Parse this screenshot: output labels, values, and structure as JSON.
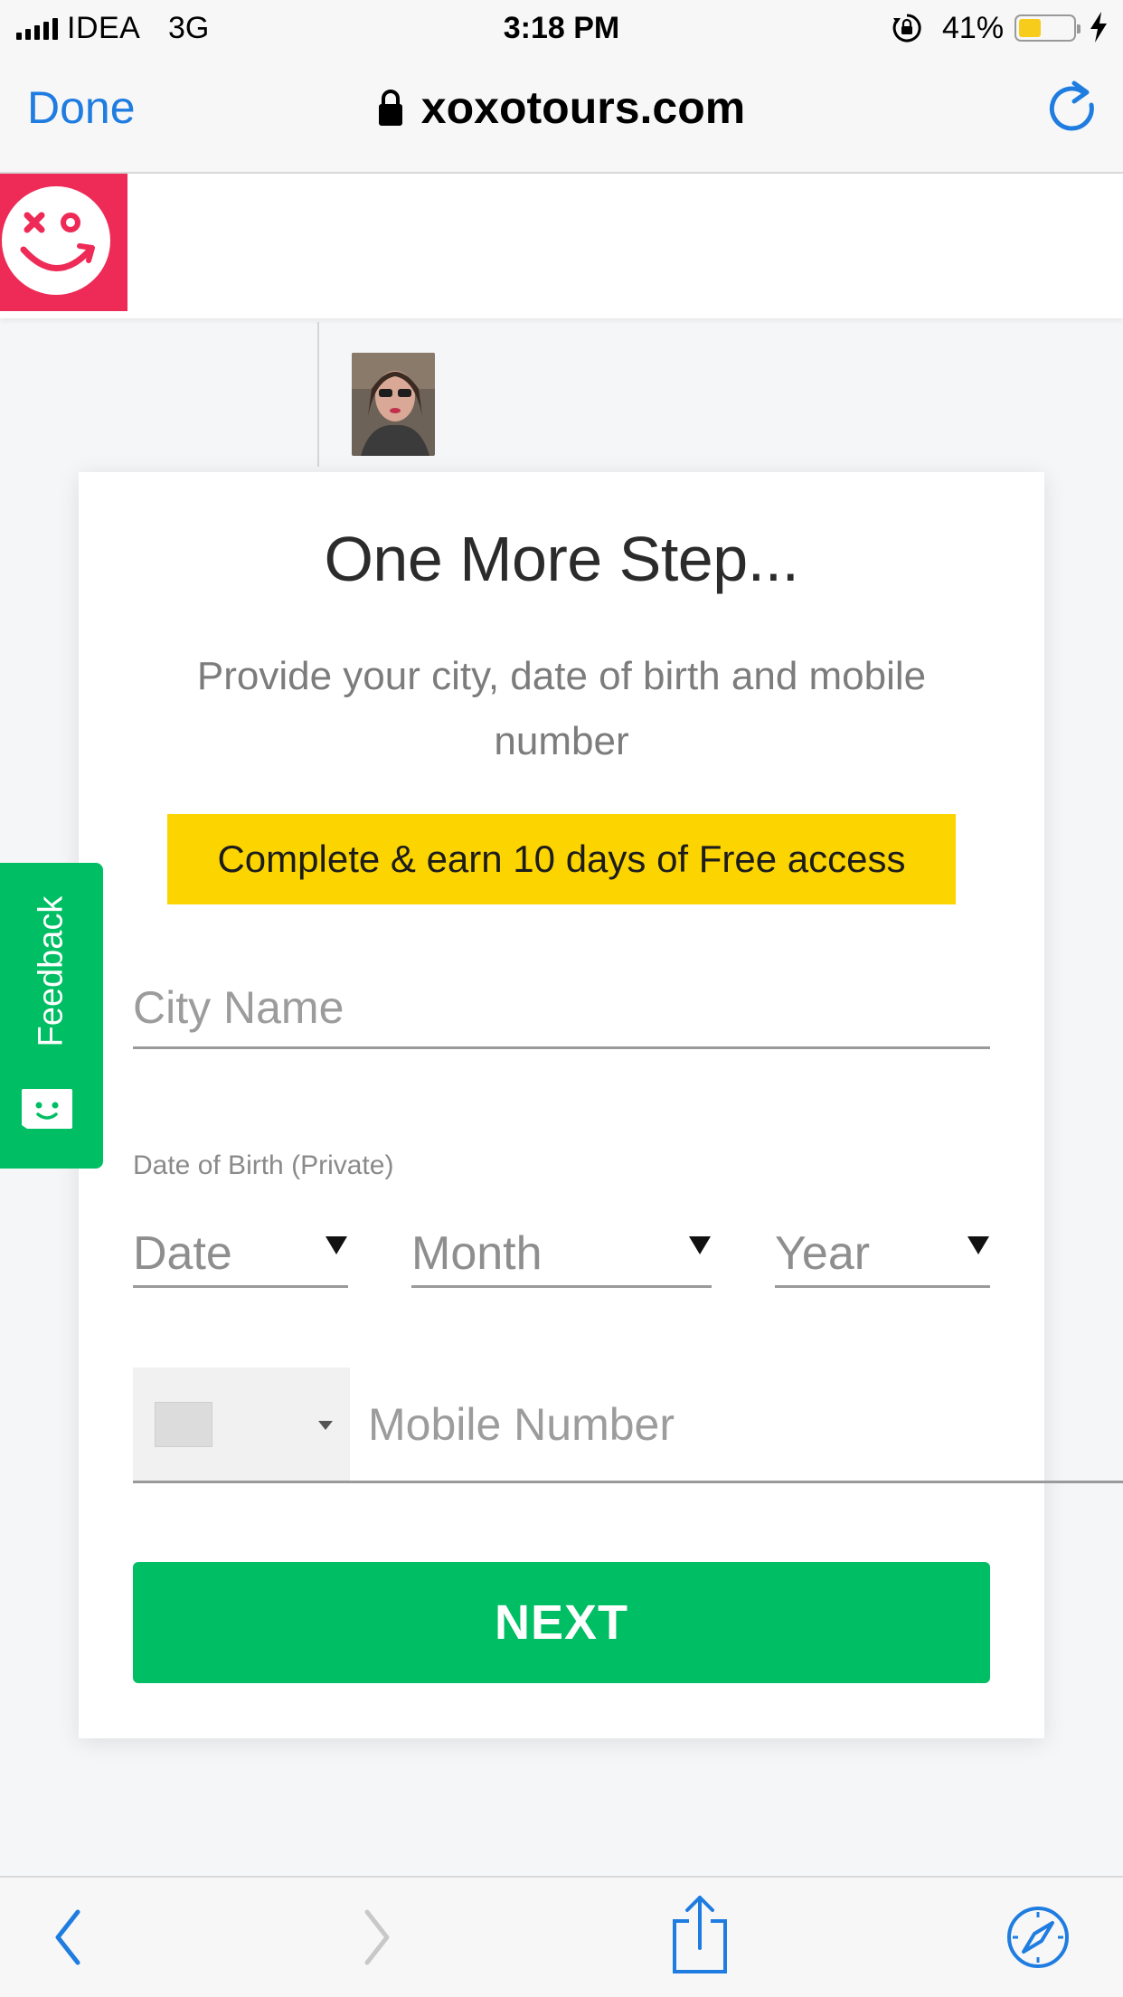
{
  "status_bar": {
    "carrier": "IDEA",
    "network": "3G",
    "time": "3:18 PM",
    "battery_percent": "41%",
    "battery_level": 0.41,
    "battery_color": "#f8cc1b",
    "icons": [
      "signal-bars-icon",
      "orientation-lock-icon",
      "battery-icon",
      "charging-bolt-icon"
    ]
  },
  "browser": {
    "done_label": "Done",
    "url": "xoxotours.com",
    "accent_color": "#1f7ce0",
    "icons": [
      "padlock-icon",
      "reload-icon"
    ]
  },
  "site": {
    "logo_color": "#ee2a56",
    "logo_icon": "xoxo-smiley-logo"
  },
  "modal": {
    "title": "One More Step...",
    "subtitle": "Provide your city, date of birth and mobile number",
    "promo": "Complete & earn 10 days of Free access",
    "promo_color": "#fcd400",
    "city_placeholder": "City Name",
    "dob_label": "Date of Birth (Private)",
    "date_selected": "Date",
    "month_selected": "Month",
    "year_selected": "Year",
    "mobile_placeholder": "Mobile Number",
    "next_label": "NEXT",
    "button_color": "#00be63"
  },
  "feedback": {
    "label": "Feedback",
    "icon": "feedback-smiley-icon"
  },
  "toolbar": {
    "icons": [
      "back-icon",
      "forward-icon",
      "share-icon",
      "compass-icon"
    ]
  }
}
